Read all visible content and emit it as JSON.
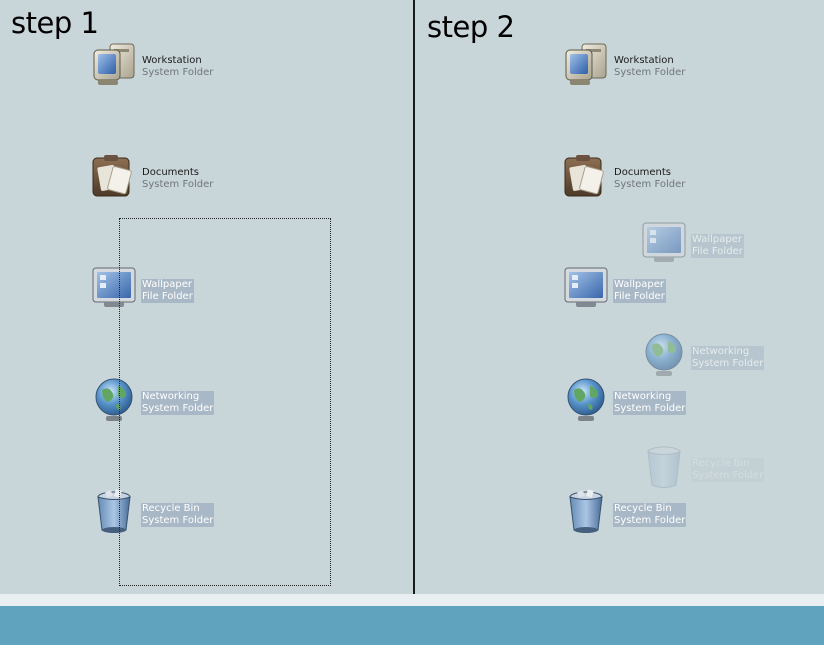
{
  "panels": [
    {
      "title": "step 1",
      "icons": [
        {
          "name": "Workstation",
          "kind": "System Folder"
        },
        {
          "name": "Documents",
          "kind": "System Folder"
        },
        {
          "name": "Wallpaper",
          "kind": "File Folder"
        },
        {
          "name": "Networking",
          "kind": "System Folder"
        },
        {
          "name": "Recycle Bin",
          "kind": "System Folder"
        }
      ]
    },
    {
      "title": "step 2",
      "icons": [
        {
          "name": "Workstation",
          "kind": "System Folder"
        },
        {
          "name": "Documents",
          "kind": "System Folder"
        },
        {
          "name": "Wallpaper",
          "kind": "File Folder"
        },
        {
          "name": "Networking",
          "kind": "System Folder"
        },
        {
          "name": "Recycle Bin",
          "kind": "System Folder"
        }
      ],
      "ghosts": [
        {
          "name": "Wallpaper",
          "kind": "File Folder"
        },
        {
          "name": "Networking",
          "kind": "System Folder"
        },
        {
          "name": "Recycle Bin",
          "kind": "System Folder"
        }
      ]
    }
  ],
  "colors": {
    "desktop": "#c9d6d9",
    "taskbar": "#5fa3bf",
    "selection_label": "#a9b8c6"
  }
}
